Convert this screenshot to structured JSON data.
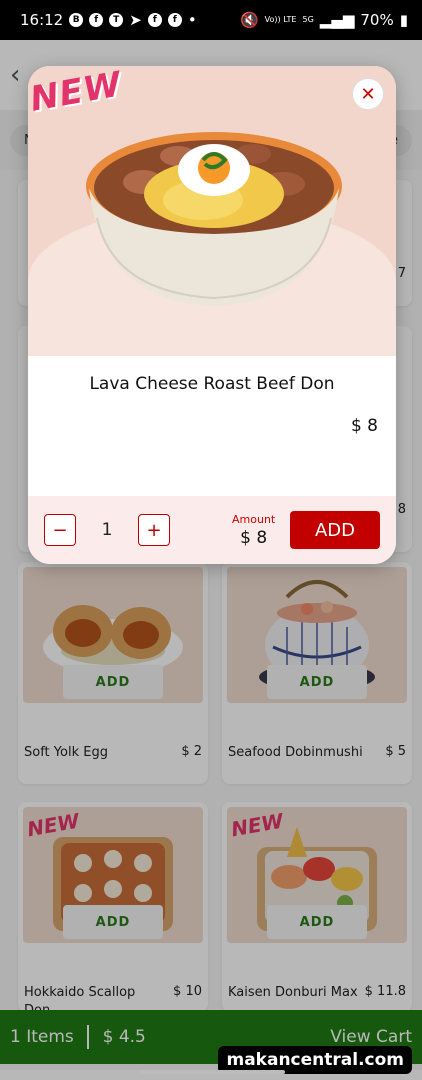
{
  "status_bar": {
    "time": "16:12",
    "battery": "70%",
    "network_lte": "Vo)) LTE",
    "network_5g": "5G"
  },
  "categories": [
    "N",
    "d De"
  ],
  "menu_items": [
    {
      "name": "Soft Yolk Egg",
      "price": "$ 2",
      "add_label": "ADD",
      "new": false
    },
    {
      "name": "Seafood Dobinmushi",
      "price": "$ 5",
      "add_label": "ADD",
      "new": false
    },
    {
      "name": "Hokkaido Scallop Don",
      "price": "$ 10",
      "add_label": "ADD",
      "new": true
    },
    {
      "name": "Kaisen Donburi Max",
      "price": "$ 11.8",
      "add_label": "ADD",
      "new": true
    }
  ],
  "hidden_prices": [
    "7",
    "8"
  ],
  "modal": {
    "new_badge": "NEW",
    "title": "Lava Cheese Roast Beef Don",
    "price": "$ 8",
    "quantity": "1",
    "amount_label": "Amount",
    "amount": "$ 8",
    "add_button": "ADD"
  },
  "cart_bar": {
    "items": "1 Items",
    "total": "$ 4.5",
    "view_cart": "View Cart"
  },
  "watermark": "makancentral.com",
  "colors": {
    "accent_red": "#c30000",
    "cart_green": "#1f7a12",
    "add_green": "#2a7a1a"
  }
}
